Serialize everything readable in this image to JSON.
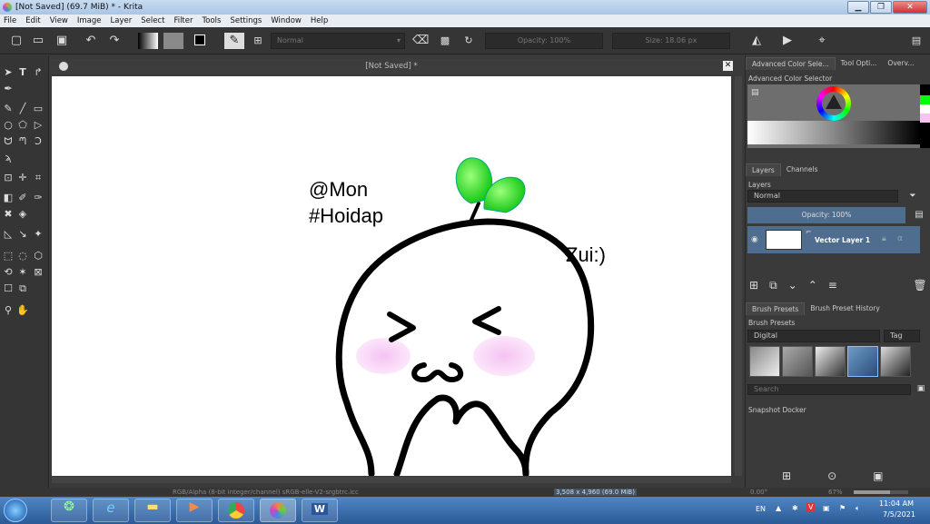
{
  "window": {
    "title": "[Not Saved]  (69.7 MiB)  * - Krita",
    "minimize": "▁",
    "maximize": "❐",
    "close": "✕"
  },
  "menu": [
    "File",
    "Edit",
    "View",
    "Image",
    "Layer",
    "Select",
    "Filter",
    "Tools",
    "Settings",
    "Window",
    "Help"
  ],
  "tool_options": {
    "blend_mode": "Normal",
    "opacity": "Opacity: 100%",
    "size": "Size: 18.06 px"
  },
  "document": {
    "tab_title": "[Not Saved]  *",
    "close_label": "✕",
    "drawing_text": {
      "line1": "@Mon",
      "line2": "#Hoidap",
      "side": "Zui:)"
    }
  },
  "dock": {
    "top_tabs": [
      "Advanced Color Sele...",
      "Tool Opti...",
      "Overv..."
    ],
    "color_selector_label": "Advanced Color Selector",
    "layers_tabs": [
      "Layers",
      "Channels"
    ],
    "layers_label": "Layers",
    "layers_blend": "Normal",
    "layers_opacity": "Opacity:  100%",
    "layer_name": "Vector Layer 1",
    "presets_tabs": [
      "Brush Presets",
      "Brush Preset History"
    ],
    "presets_label": "Brush Presets",
    "presets_filter": "Digital",
    "tag_label": "Tag",
    "search_placeholder": "Search",
    "snapshot_label": "Snapshot Docker"
  },
  "status": {
    "color_space": "RGB/Alpha (8-bit integer/channel)  sRGB-elle-V2-srgbtrc.icc",
    "dimensions": "3,508 x 4,960 (69.0 MiB)",
    "rotation": "0.00°",
    "zoom": "67%"
  },
  "taskbar": {
    "language": "EN",
    "time": "11:04 AM",
    "date": "7/5/2021"
  },
  "colors": {
    "accent_layer": "#4f6e8f",
    "sprout": "#3fe02c",
    "blush": "#f4c4f0"
  }
}
